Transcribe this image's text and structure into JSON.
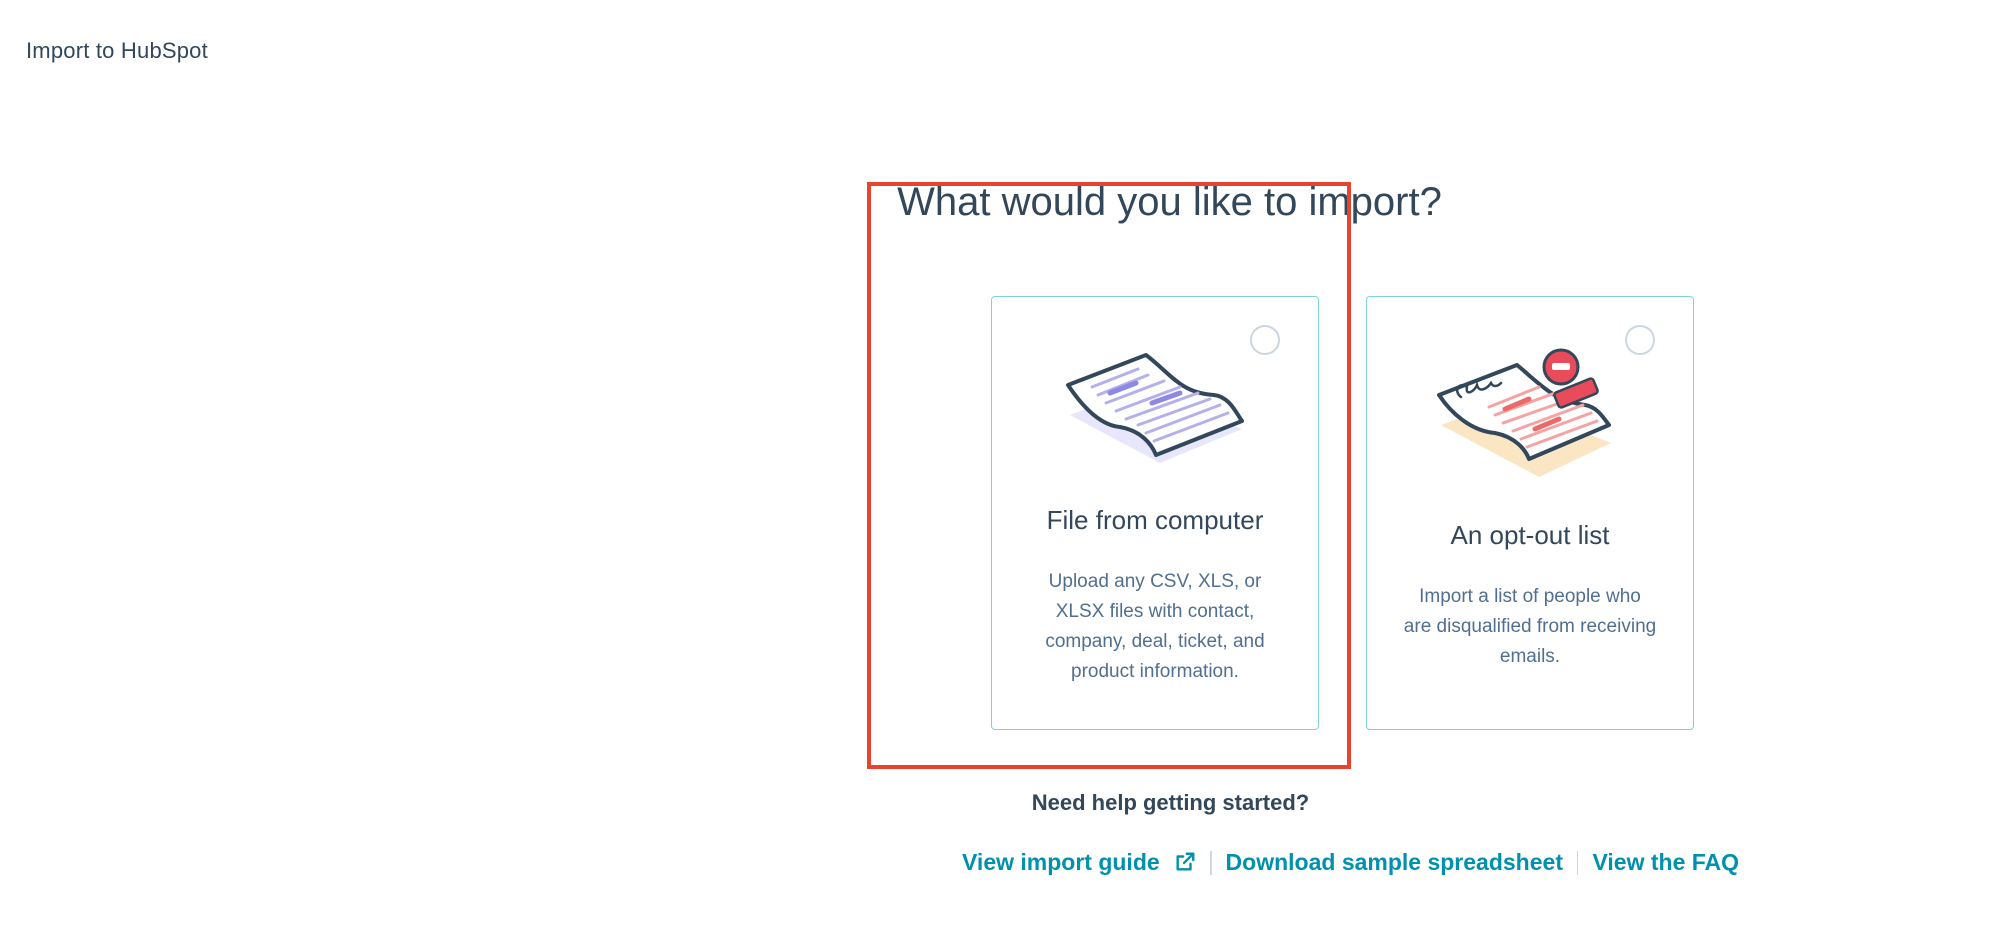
{
  "header": {
    "title": "Import to HubSpot"
  },
  "main": {
    "heading": "What would you like to import?",
    "cards": [
      {
        "title": "File from computer",
        "description": "Upload any CSV, XLS, or XLSX files with contact, company, deal, ticket, and product information.",
        "icon": "file-document-icon"
      },
      {
        "title": "An opt-out list",
        "description": "Import a list of people who are disqualified from receiving emails.",
        "icon": "opt-out-document-icon"
      }
    ]
  },
  "help": {
    "title": "Need help getting started?",
    "links": {
      "guide": "View import guide",
      "sample": "Download sample spreadsheet",
      "faq": "View the FAQ"
    }
  },
  "colors": {
    "text": "#33475b",
    "muted": "#516f90",
    "link": "#0091ae",
    "card_border": "#7fd1de",
    "highlight": "#e8432e"
  }
}
